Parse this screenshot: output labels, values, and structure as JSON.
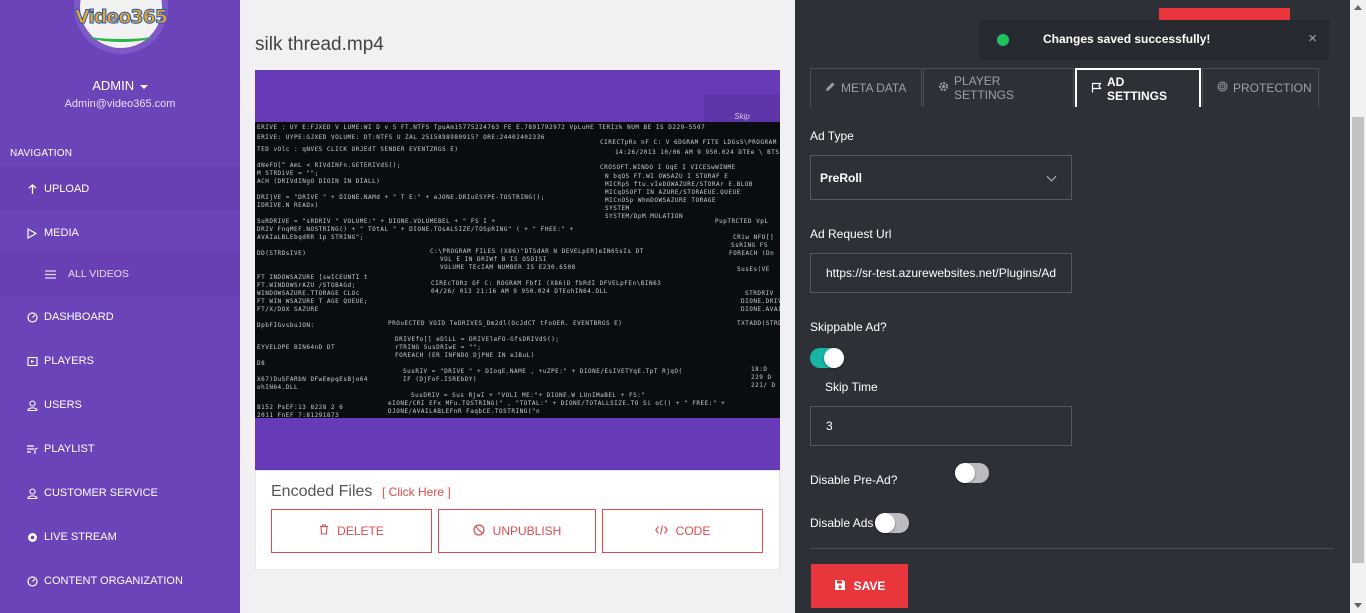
{
  "brand": {
    "logo_text": "Video365"
  },
  "user": {
    "name": "ADMIN",
    "email": "Admin@video365.com"
  },
  "nav": {
    "title": "NAVIGATION",
    "items": [
      {
        "label": "UPLOAD",
        "icon": "upload-icon"
      },
      {
        "label": "MEDIA",
        "icon": "play-icon"
      },
      {
        "label": "ALL VIDEOS",
        "icon": "list-icon"
      },
      {
        "label": "DASHBOARD",
        "icon": "gauge-icon"
      },
      {
        "label": "PLAYERS",
        "icon": "player-icon"
      },
      {
        "label": "USERS",
        "icon": "user-icon"
      },
      {
        "label": "PLAYLIST",
        "icon": "playlist-icon"
      },
      {
        "label": "CUSTOMER SERVICE",
        "icon": "user-icon"
      },
      {
        "label": "LIVE STREAM",
        "icon": "live-icon"
      },
      {
        "label": "CONTENT ORGANIZATION",
        "icon": "gauge-icon"
      }
    ]
  },
  "media": {
    "title": "silk thread.mp4",
    "skip_label": "Skip",
    "encoded_title": "Encoded Files",
    "encoded_link": "[ Click Here ]",
    "buttons": {
      "delete": "DELETE",
      "unpublish": "UNPUBLISH",
      "code": "CODE"
    }
  },
  "toast": {
    "message": "Changes saved successfully!",
    "close": "×"
  },
  "tabs": [
    {
      "label": "META DATA",
      "icon": "pencil-icon"
    },
    {
      "label": "PLAYER SETTINGS",
      "icon": "gear-icon"
    },
    {
      "label": "AD SETTINGS",
      "icon": "flag-icon",
      "active": true
    },
    {
      "label": "PROTECTION",
      "icon": "target-icon"
    }
  ],
  "ad_settings": {
    "ad_type_label": "Ad Type",
    "ad_type_value": "PreRoll",
    "ad_request_label": "Ad Request Url",
    "ad_request_value": "https://sr-test.azurewebsites.net/Plugins/Ad",
    "skippable_label": "Skippable Ad?",
    "skippable": true,
    "skip_time_label": "Skip Time",
    "skip_time_value": "3",
    "disable_pre_label": "Disable Pre-Ad?",
    "disable_pre": false,
    "disable_ads_label": "Disable Ads",
    "disable_ads": false,
    "save_label": "SAVE"
  },
  "colors": {
    "sidebar": "#6c44b9",
    "panel": "#2e3038",
    "accent_red": "#e9353c",
    "toggle_on": "#19b5a3",
    "success": "#1ec15c"
  }
}
